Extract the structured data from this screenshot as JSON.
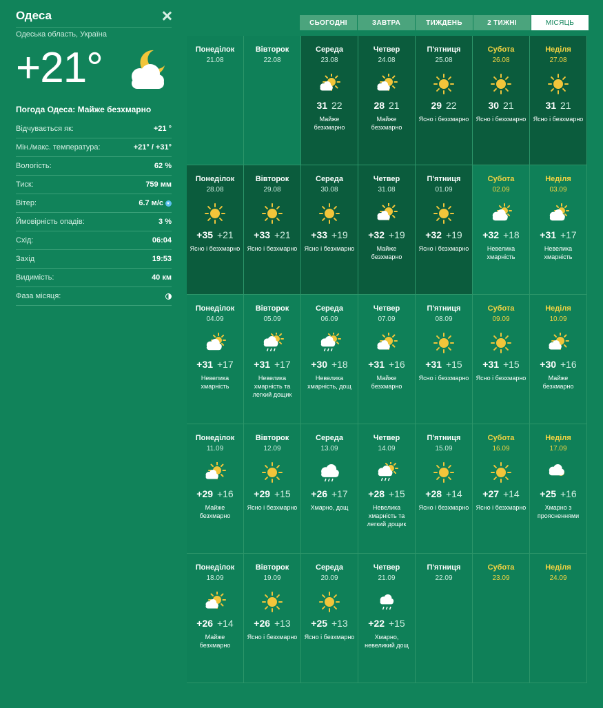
{
  "location": {
    "city": "Одеса",
    "region": "Одеська область, Україна"
  },
  "current": {
    "temperature": "+21°",
    "summary": "Погода Одеса: Майже безхмарно",
    "icon": "partly-cloudy-night-icon",
    "details": [
      {
        "label": "Відчувається як:",
        "value": "+21 °"
      },
      {
        "label": "Мін./макс. температура:",
        "value": "+21° / +31°"
      },
      {
        "label": "Вологість:",
        "value": "62 %"
      },
      {
        "label": "Тиск:",
        "value": "759 мм"
      },
      {
        "label": "Вітер:",
        "value": "6.7 м/с"
      },
      {
        "label": "Ймовірність опадів:",
        "value": "3 %"
      },
      {
        "label": "Схід:",
        "value": "06:04"
      },
      {
        "label": "Захід",
        "value": "19:53"
      },
      {
        "label": "Видимість:",
        "value": "40 км"
      },
      {
        "label": "Фаза місяця:",
        "value": ""
      }
    ]
  },
  "tabs": [
    {
      "label": "СЬОГОДНІ",
      "active": false
    },
    {
      "label": "ЗАВТРА",
      "active": false
    },
    {
      "label": "ТИЖДЕНЬ",
      "active": false
    },
    {
      "label": "2 ТИЖНІ",
      "active": false
    },
    {
      "label": "МІСЯЦЬ",
      "active": true
    }
  ],
  "colors": {
    "background": "#11835a",
    "dark_cell": "#0b5c3d",
    "weekend_text": "#f5d442",
    "sun": "#f2c53a"
  },
  "weeks": [
    [
      {
        "name": "Понеділок",
        "date": "21.08",
        "empty": true
      },
      {
        "name": "Вівторок",
        "date": "22.08",
        "empty": true
      },
      {
        "name": "Середа",
        "date": "23.08",
        "icon": "partly-cloudy",
        "max": "31",
        "min": "22",
        "desc": "Майже безхмарно"
      },
      {
        "name": "Четвер",
        "date": "24.08",
        "icon": "partly-cloudy",
        "max": "28",
        "min": "21",
        "desc": "Майже безхмарно"
      },
      {
        "name": "П'ятниця",
        "date": "25.08",
        "icon": "sun",
        "max": "29",
        "min": "22",
        "desc": "Ясно і безхмарно"
      },
      {
        "name": "Субота",
        "date": "26.08",
        "icon": "sun",
        "max": "30",
        "min": "21",
        "desc": "Ясно і безхмарно",
        "weekend": true
      },
      {
        "name": "Неділя",
        "date": "27.08",
        "icon": "sun",
        "max": "31",
        "min": "21",
        "desc": "Ясно і безхмарно",
        "weekend": true
      }
    ],
    [
      {
        "name": "Понеділок",
        "date": "28.08",
        "icon": "sun",
        "max": "+35",
        "min": "+21",
        "desc": "Ясно і безхмарно"
      },
      {
        "name": "Вівторок",
        "date": "29.08",
        "icon": "sun",
        "max": "+33",
        "min": "+21",
        "desc": "Ясно і безхмарно"
      },
      {
        "name": "Середа",
        "date": "30.08",
        "icon": "sun",
        "max": "+33",
        "min": "+19",
        "desc": "Ясно і безхмарно"
      },
      {
        "name": "Четвер",
        "date": "31.08",
        "icon": "partly-cloudy",
        "max": "+32",
        "min": "+19",
        "desc": "Майже безхмарно"
      },
      {
        "name": "П'ятниця",
        "date": "01.09",
        "icon": "sun",
        "max": "+32",
        "min": "+19",
        "desc": "Ясно і безхмарно"
      },
      {
        "name": "Субота",
        "date": "02.09",
        "icon": "cloudy-sun",
        "max": "+32",
        "min": "+18",
        "desc": "Невелика хмарність",
        "weekend": true
      },
      {
        "name": "Неділя",
        "date": "03.09",
        "icon": "cloudy-sun",
        "max": "+31",
        "min": "+17",
        "desc": "Невелика хмарність",
        "weekend": true
      }
    ],
    [
      {
        "name": "Понеділок",
        "date": "04.09",
        "icon": "cloudy-sun",
        "max": "+31",
        "min": "+17",
        "desc": "Невелика хмарність"
      },
      {
        "name": "Вівторок",
        "date": "05.09",
        "icon": "cloudy-sun-rain",
        "max": "+31",
        "min": "+17",
        "desc": "Невелика хмарність та легкий дощик"
      },
      {
        "name": "Середа",
        "date": "06.09",
        "icon": "cloudy-sun-rain",
        "max": "+30",
        "min": "+18",
        "desc": "Невелика хмарність, дощ"
      },
      {
        "name": "Четвер",
        "date": "07.09",
        "icon": "partly-cloudy",
        "max": "+31",
        "min": "+16",
        "desc": "Майже безхмарно"
      },
      {
        "name": "П'ятниця",
        "date": "08.09",
        "icon": "sun",
        "max": "+31",
        "min": "+15",
        "desc": "Ясно і безхмарно"
      },
      {
        "name": "Субота",
        "date": "09.09",
        "icon": "sun",
        "max": "+31",
        "min": "+15",
        "desc": "Ясно і безхмарно",
        "weekend": true
      },
      {
        "name": "Неділя",
        "date": "10.09",
        "icon": "partly-cloudy",
        "max": "+30",
        "min": "+16",
        "desc": "Майже безхмарно",
        "weekend": true
      }
    ],
    [
      {
        "name": "Понеділок",
        "date": "11.09",
        "icon": "partly-cloudy",
        "max": "+29",
        "min": "+16",
        "desc": "Майже безхмарно"
      },
      {
        "name": "Вівторок",
        "date": "12.09",
        "icon": "sun",
        "max": "+29",
        "min": "+15",
        "desc": "Ясно і безхмарно"
      },
      {
        "name": "Середа",
        "date": "13.09",
        "icon": "cloud-rain",
        "max": "+26",
        "min": "+17",
        "desc": "Хмарно, дощ"
      },
      {
        "name": "Четвер",
        "date": "14.09",
        "icon": "cloudy-sun-rain",
        "max": "+28",
        "min": "+15",
        "desc": "Невелика хмарність та легкий дощик"
      },
      {
        "name": "П'ятниця",
        "date": "15.09",
        "icon": "sun",
        "max": "+28",
        "min": "+14",
        "desc": "Ясно і безхмарно"
      },
      {
        "name": "Субота",
        "date": "16.09",
        "icon": "sun",
        "max": "+27",
        "min": "+14",
        "desc": "Ясно і безхмарно",
        "weekend": true
      },
      {
        "name": "Неділя",
        "date": "17.09",
        "icon": "cloud-sun-behind",
        "max": "+25",
        "min": "+16",
        "desc": "Хмарно з проясненнями",
        "weekend": true
      }
    ],
    [
      {
        "name": "Понеділок",
        "date": "18.09",
        "icon": "partly-cloudy",
        "max": "+26",
        "min": "+14",
        "desc": "Майже безхмарно"
      },
      {
        "name": "Вівторок",
        "date": "19.09",
        "icon": "sun",
        "max": "+26",
        "min": "+13",
        "desc": "Ясно і безхмарно"
      },
      {
        "name": "Середа",
        "date": "20.09",
        "icon": "sun",
        "max": "+25",
        "min": "+13",
        "desc": "Ясно і безхмарно"
      },
      {
        "name": "Четвер",
        "date": "21.09",
        "icon": "cloud-rain-small",
        "max": "+22",
        "min": "+15",
        "desc": "Хмарно, невеликий дощ"
      },
      {
        "name": "П'ятниця",
        "date": "22.09",
        "empty": true
      },
      {
        "name": "Субота",
        "date": "23.09",
        "empty": true,
        "weekend": true
      },
      {
        "name": "Неділя",
        "date": "24.09",
        "empty": true,
        "weekend": true
      }
    ]
  ]
}
